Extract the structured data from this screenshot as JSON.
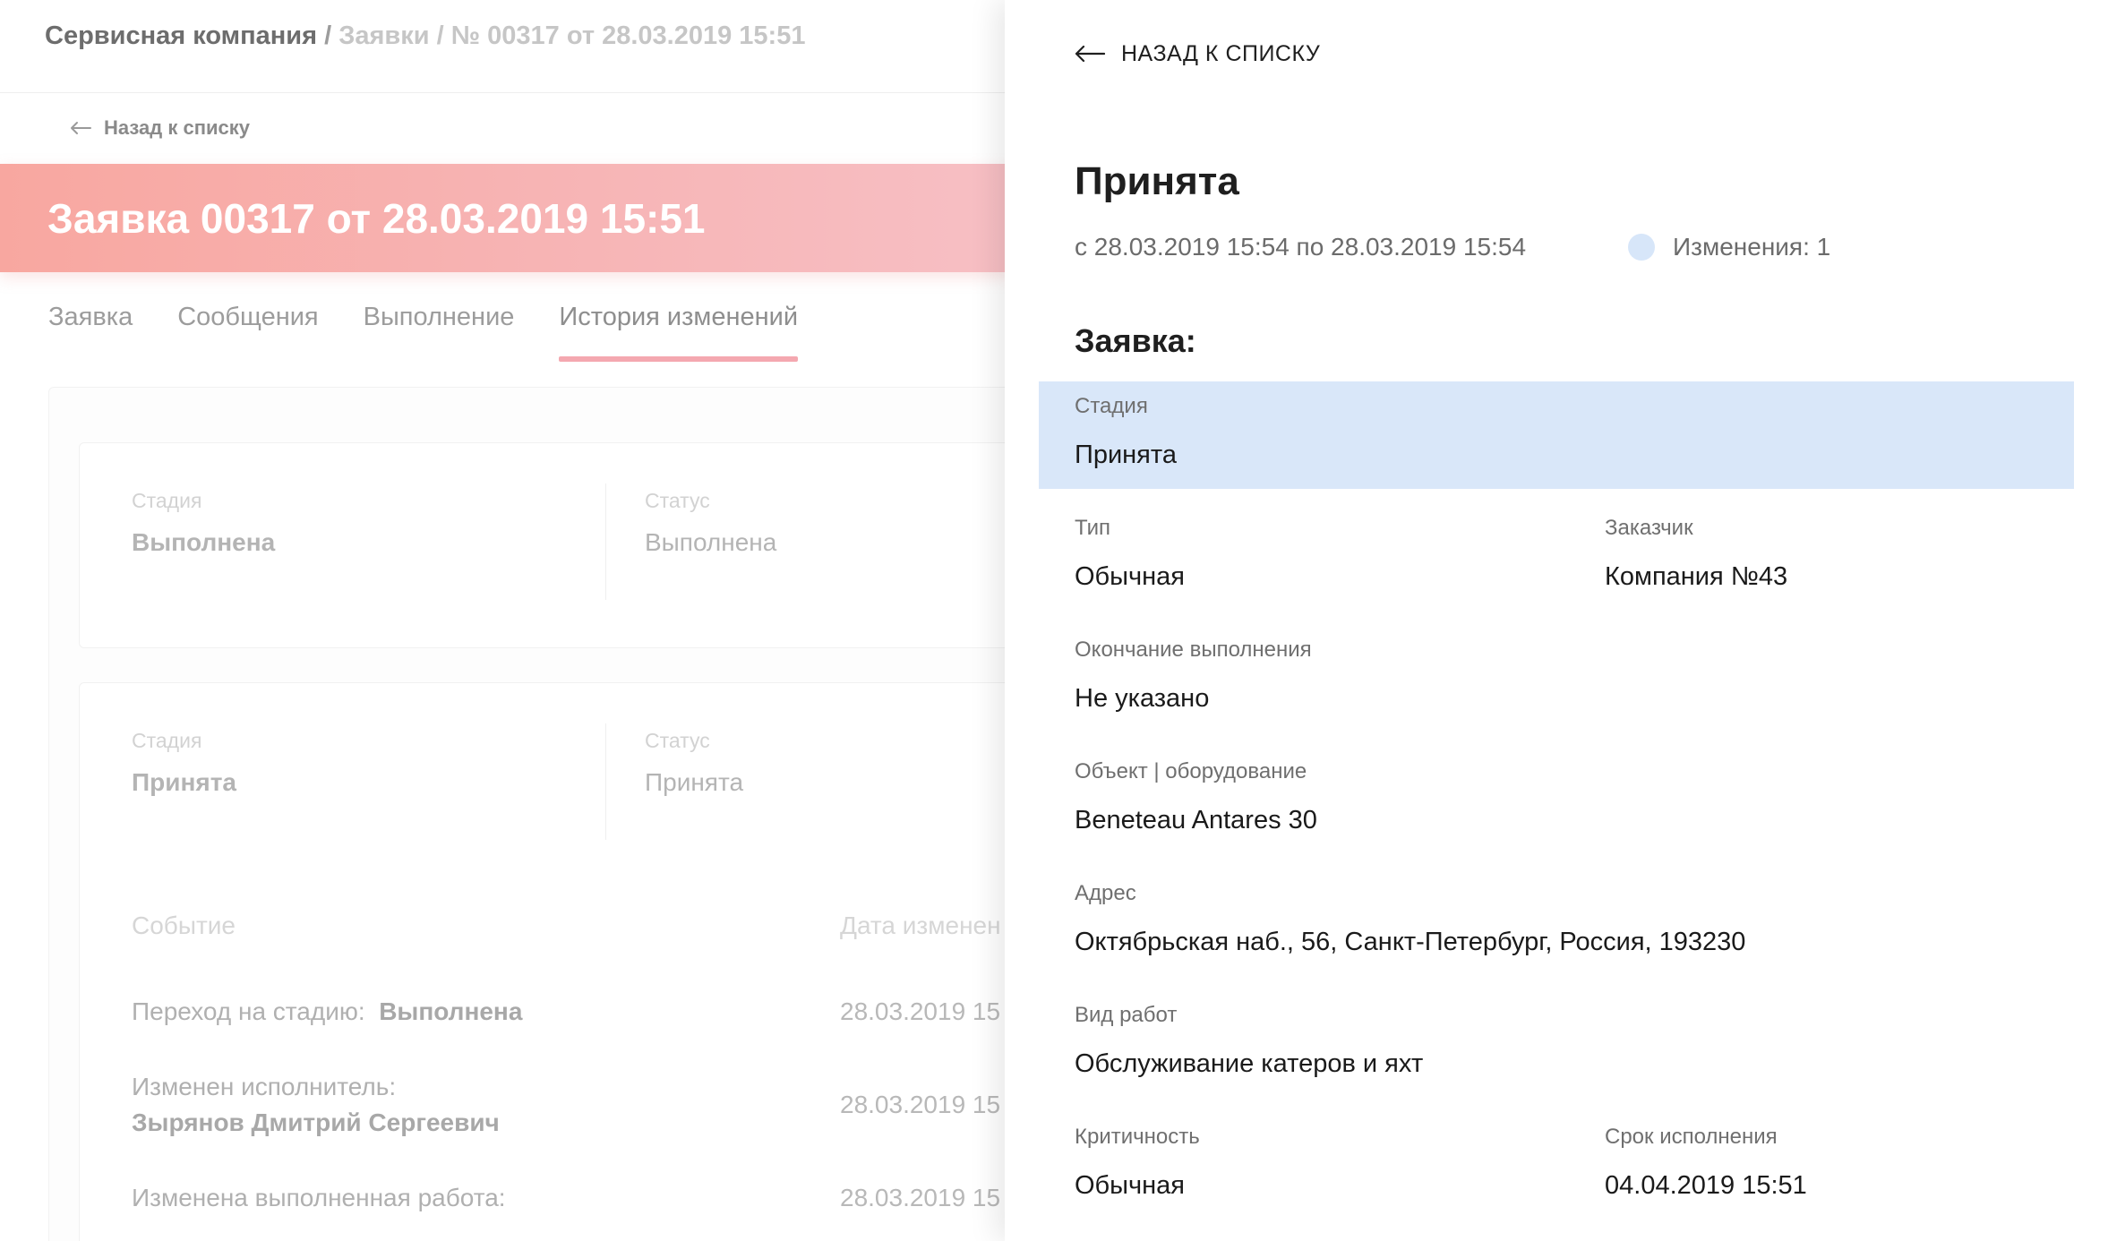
{
  "breadcrumb": {
    "root": "Сервисная компания",
    "sep1": " / ",
    "section": "Заявки",
    "sep2": " / ",
    "current": "№ 00317 от 28.03.2019 15:51"
  },
  "back_small_label": "Назад к списку",
  "banner_title": "Заявка 00317 от 28.03.2019 15:51",
  "tabs": [
    {
      "label": "Заявка",
      "active": false
    },
    {
      "label": "Сообщения",
      "active": false
    },
    {
      "label": "Выполнение",
      "active": false
    },
    {
      "label": "История изменений",
      "active": true
    }
  ],
  "history_cards": [
    {
      "stage_label": "Стадия",
      "stage_value": "Выполнена",
      "status_label": "Статус",
      "status_value": "Выполнена"
    },
    {
      "stage_label": "Стадия",
      "stage_value": "Принята",
      "status_label": "Статус",
      "status_value": "Принята"
    }
  ],
  "events": {
    "col_event": "Событие",
    "col_date": "Дата изменен",
    "rows": [
      {
        "text": "Переход на стадию:",
        "bold": "Выполнена",
        "date": "28.03.2019 15"
      },
      {
        "text": "Изменен исполнитель:",
        "bold": "Зырянов Дмитрий Сергеевич",
        "date": "28.03.2019 15"
      },
      {
        "text": "Изменена выполненная работа:",
        "bold": "",
        "date": "28.03.2019 15"
      }
    ]
  },
  "drawer": {
    "back_label": "НАЗАД К СПИСКУ",
    "title": "Принята",
    "period": "с 28.03.2019 15:54 по 28.03.2019 15:54",
    "changes_label": "Изменения: 1",
    "changes_color": "#d7e6f9",
    "section_title": "Заявка:",
    "fields": {
      "stage": {
        "label": "Стадия",
        "value": "Принята"
      },
      "type": {
        "label": "Тип",
        "value": "Обычная"
      },
      "customer": {
        "label": "Заказчик",
        "value": "Компания №43"
      },
      "end": {
        "label": "Окончание выполнения",
        "value": "Не указано"
      },
      "object": {
        "label": "Объект | оборудование",
        "value": "Beneteau Antares 30"
      },
      "address": {
        "label": "Адрес",
        "value": "Октябрьская наб., 56, Санкт-Петербург, Россия, 193230"
      },
      "work_type": {
        "label": "Вид работ",
        "value": "Обслуживание катеров и яхт"
      },
      "criticality": {
        "label": "Критичность",
        "value": "Обычная"
      },
      "deadline": {
        "label": "Срок исполнения",
        "value": "04.04.2019 15:51"
      }
    }
  },
  "colors": {
    "banner_start": "#f8a7a0",
    "banner_end": "#f7bfc4",
    "tab_underline": "#f4a8b0",
    "highlight": "#d9e7f9"
  }
}
